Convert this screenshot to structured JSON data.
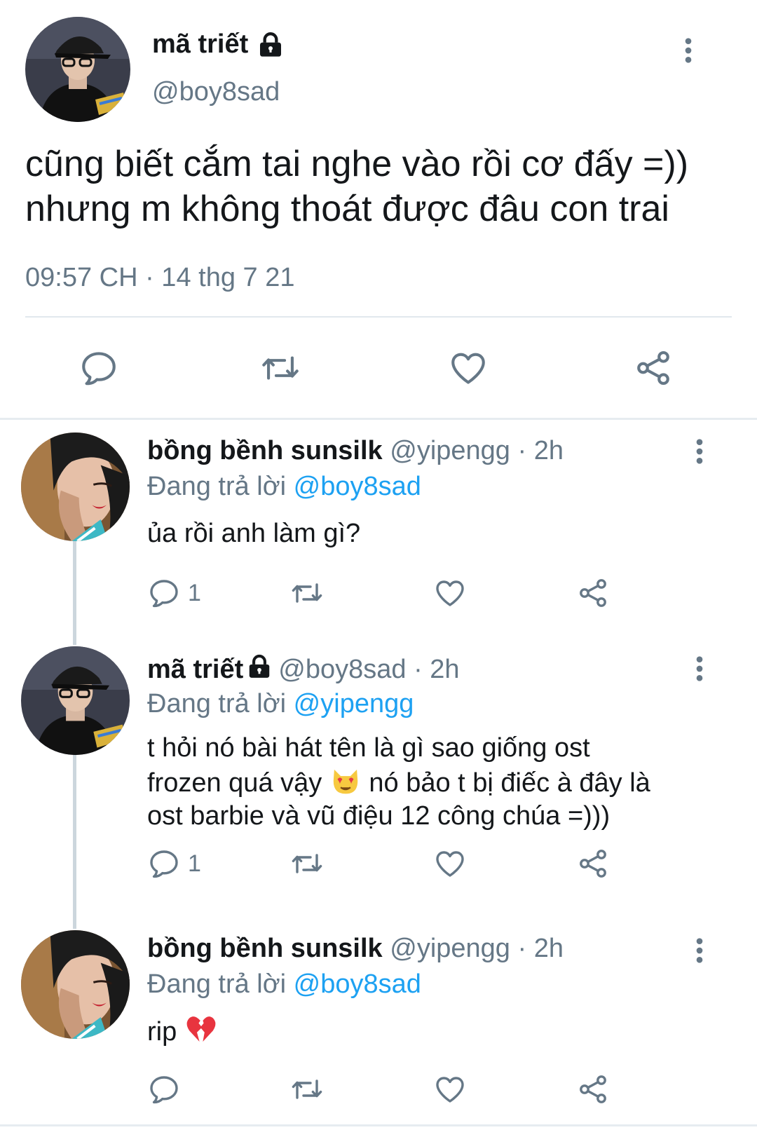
{
  "tweet": {
    "author_name": "mã triết",
    "author_handle": "@boy8sad",
    "text_line1": "cũng biết cắm tai nghe vào rồi cơ đấy =))",
    "text_line2": "nhưng m không thoát được đâu con trai",
    "meta": "09:57 CH · 14 thg 7 21",
    "icons": [
      "reply-icon",
      "retweet-icon",
      "like-icon",
      "share-icon",
      "lock-icon",
      "more-icon"
    ]
  },
  "replies": [
    {
      "name": "bồng bềnh sunsilk",
      "handle_time": "@yipengg · 2h",
      "replying_label": "Đang trả lời",
      "replying_to": "@boy8sad",
      "text_lines": [
        "ủa rồi anh làm gì?"
      ],
      "reply_count": "1"
    },
    {
      "name": "mã triết",
      "handle_time": "@boy8sad · 2h",
      "replying_label": "Đang trả lời",
      "replying_to": "@yipengg",
      "text_line1": "t hỏi nó bài hát tên là gì sao giống ost",
      "text_line2_a": "frozen quá vậy",
      "text_line2_b": "nó bảo t bị điếc à đây là",
      "text_line3": "ost barbie và vũ điệu 12 công chúa =)))",
      "emoji": "smiling-cat-heart-eyes",
      "reply_count": "1"
    },
    {
      "name": "bồng bềnh sunsilk",
      "handle_time": "@yipengg · 2h",
      "replying_label": "Đang trả lời",
      "replying_to": "@boy8sad",
      "text": "rip",
      "emoji": "broken-heart",
      "reply_count": ""
    }
  ],
  "colors": {
    "text": "#14171a",
    "secondary": "#657786",
    "link": "#1da1f2",
    "icon": "#657786",
    "divider": "#e1e8ed"
  }
}
